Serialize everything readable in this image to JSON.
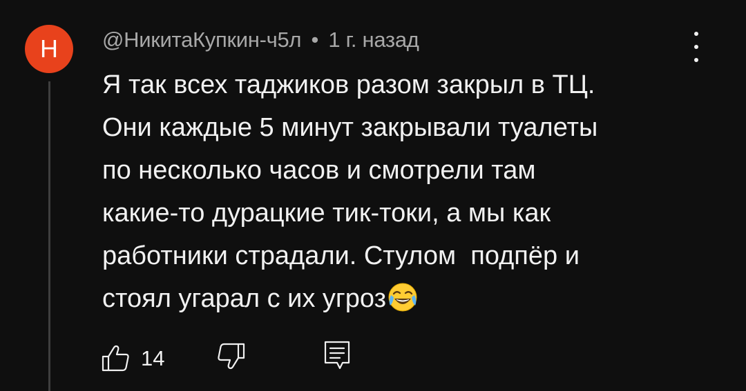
{
  "comment": {
    "avatar": {
      "letter": "Н",
      "color": "#e8421c"
    },
    "author": "@НикитаКупкин-ч5л",
    "separator": "•",
    "timestamp": "1 г. назад",
    "text_lines": [
      "Я так всех таджиков разом закрыл в ТЦ.",
      "Они каждые 5 минут закрывали туалеты",
      "по несколько часов и смотрели там",
      "какие-то дурацкие тик-токи, а мы как",
      "работники страдали. Стулом  подпёр и",
      "стоял угарал с их угроз"
    ],
    "emoji": "face-with-tears-of-joy-emoji"
  },
  "actions": {
    "like_icon": "thumbs-up-icon",
    "like_count": "14",
    "dislike_icon": "thumbs-down-icon",
    "reply_icon": "reply-comment-icon"
  },
  "menu_icon": "more-vert-icon",
  "colors": {
    "background": "#0f0f0f",
    "text_primary": "#f1f1f1",
    "text_secondary": "#a8a8a8",
    "thread_line": "#3f3f3f"
  }
}
